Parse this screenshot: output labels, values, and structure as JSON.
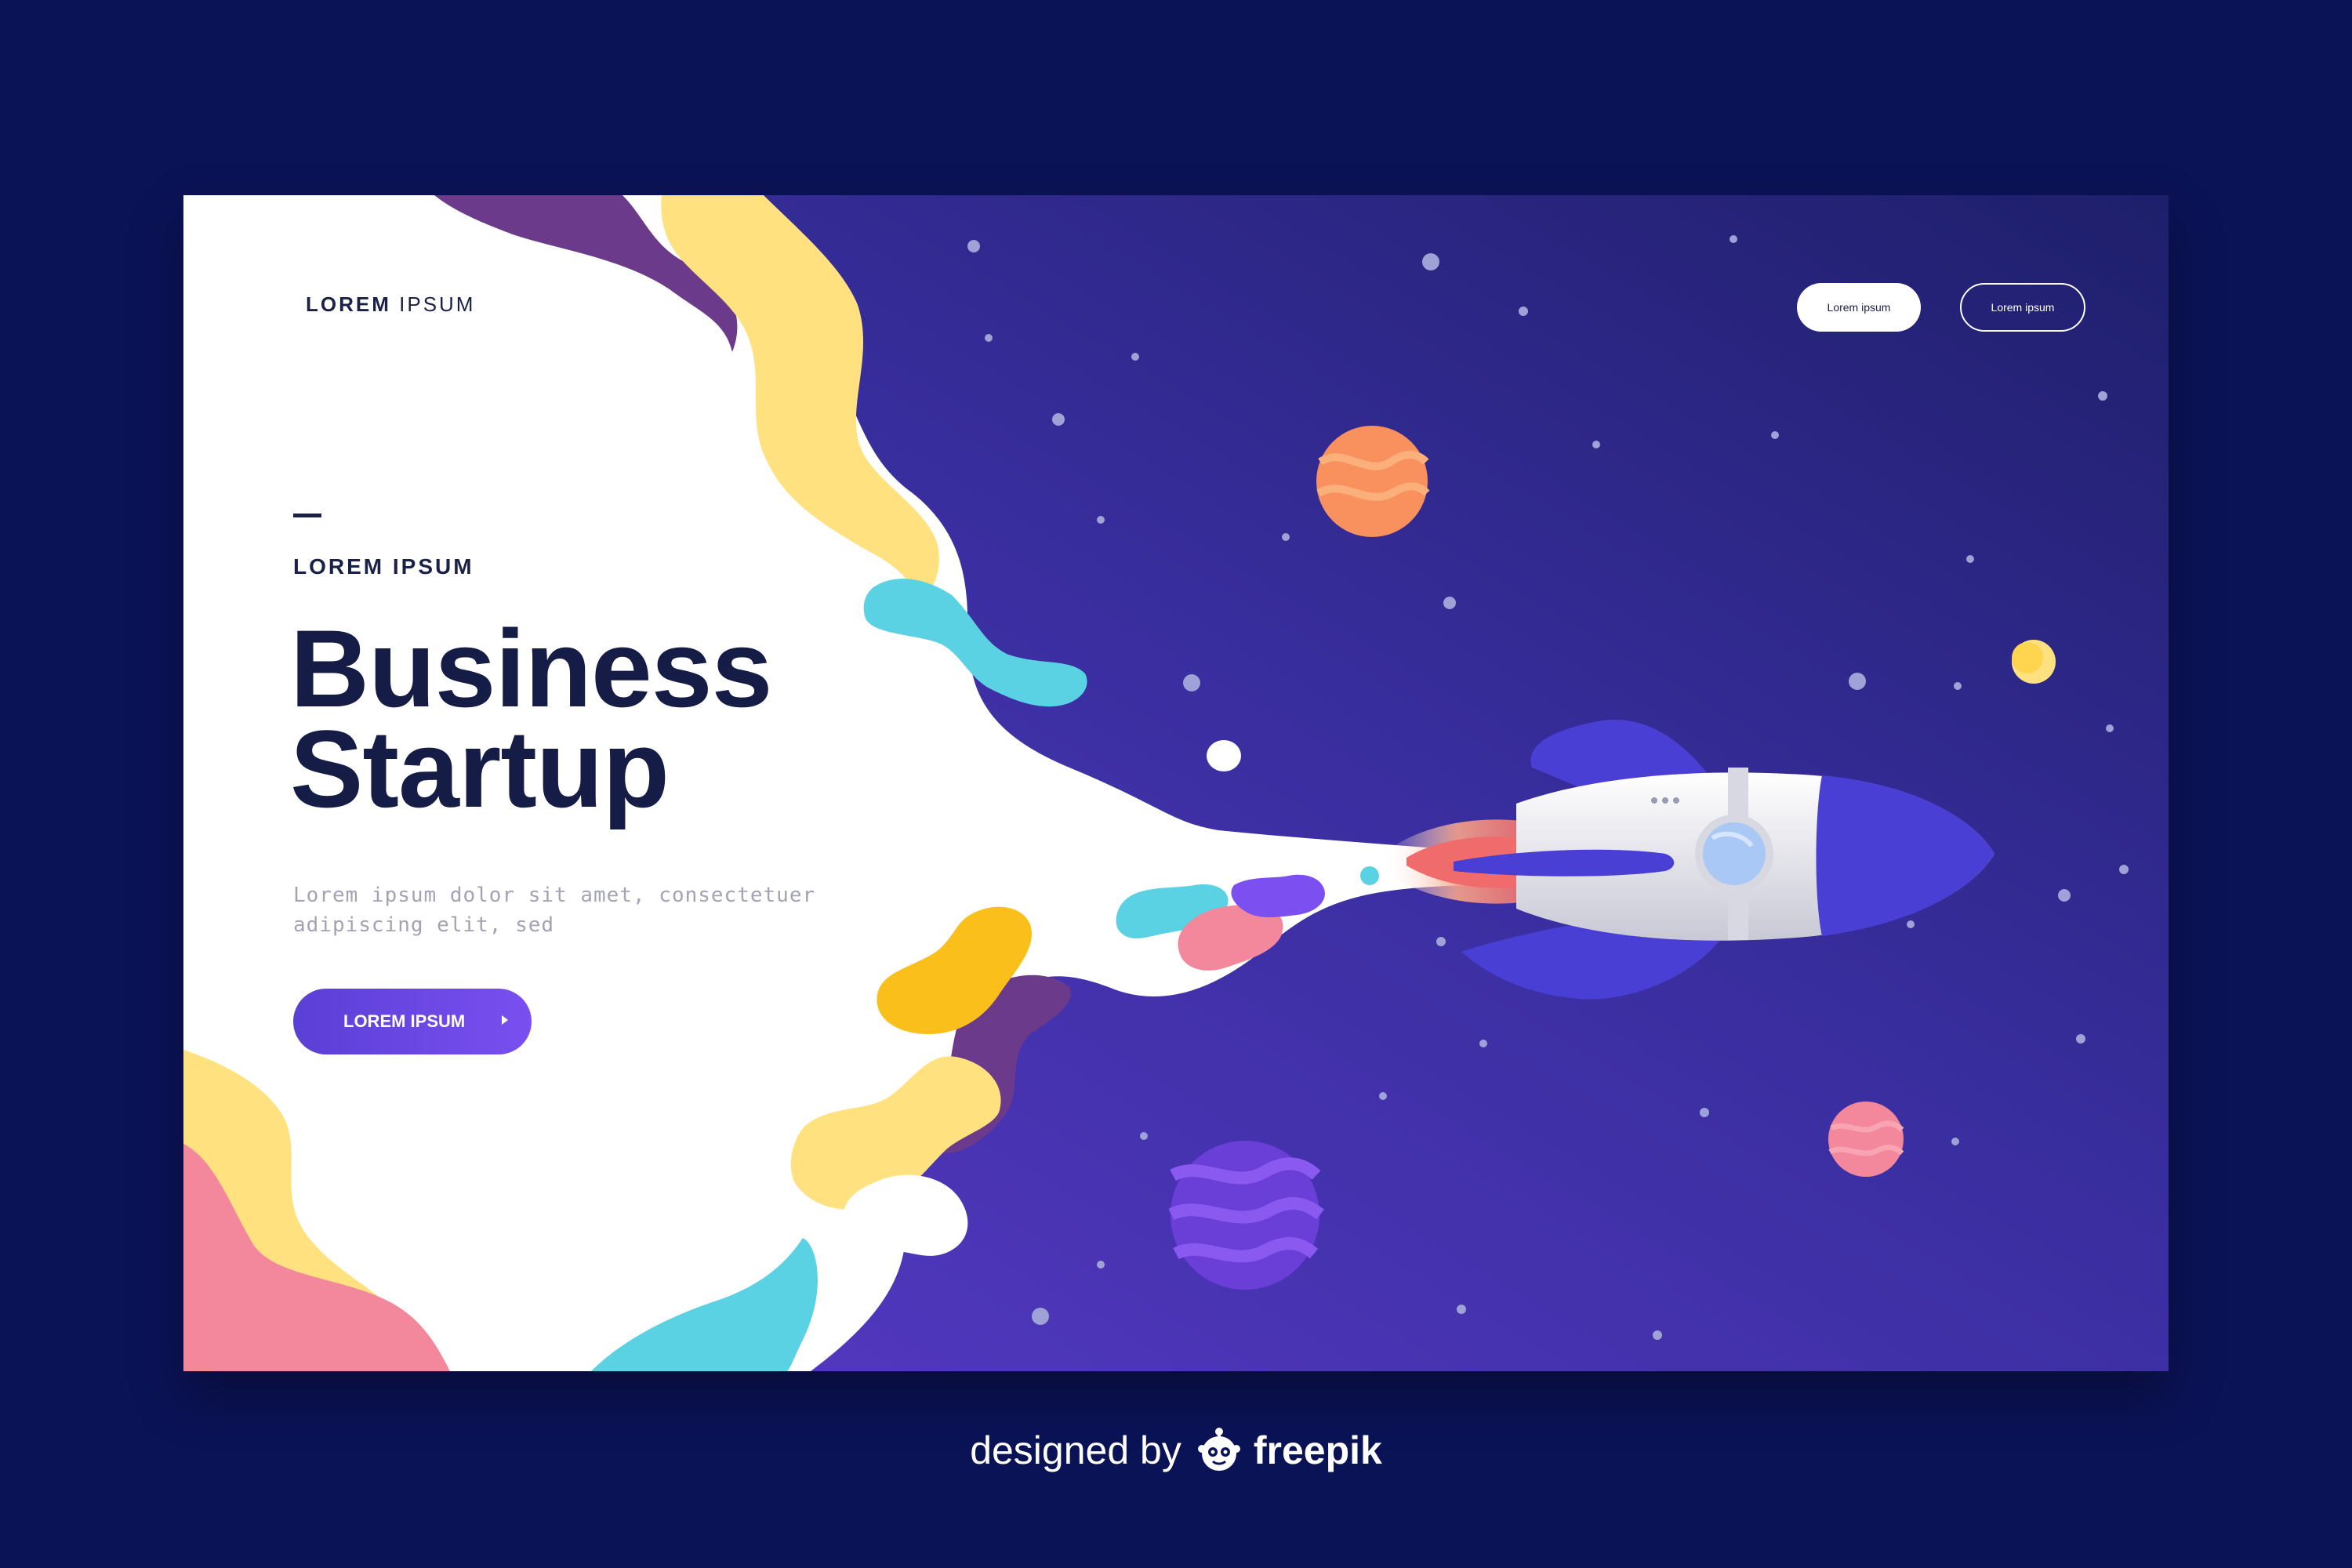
{
  "logo": {
    "bold": "LOREM",
    "light": "IPSUM"
  },
  "nav": {
    "primary_label": "Lorem ipsum",
    "secondary_label": "Lorem ipsum"
  },
  "hero": {
    "eyebrow": "LOREM IPSUM",
    "headline_line1": "Business",
    "headline_line2": "Startup",
    "body": "Lorem ipsum dolor sit amet, consectetuer adipiscing elit, sed",
    "cta_label": "LOREM IPSUM"
  },
  "credit": {
    "designed_by": "designed by",
    "brand": "freepik"
  },
  "colors": {
    "background": "#0b1357",
    "space_gradient_start": "#5a3bc9",
    "space_gradient_end": "#1e1f6b",
    "headline": "#151c45",
    "cta": "#6a48e6",
    "yellow": "#ffe17f",
    "pink": "#f3879b",
    "cyan": "#5bd1e4",
    "purple": "#6b3a8a"
  },
  "icons": [
    "rocket-illustration",
    "planet-orange",
    "planet-purple",
    "planet-pink",
    "planet-yellow",
    "freepik-mascot-icon",
    "play-arrow-icon"
  ]
}
